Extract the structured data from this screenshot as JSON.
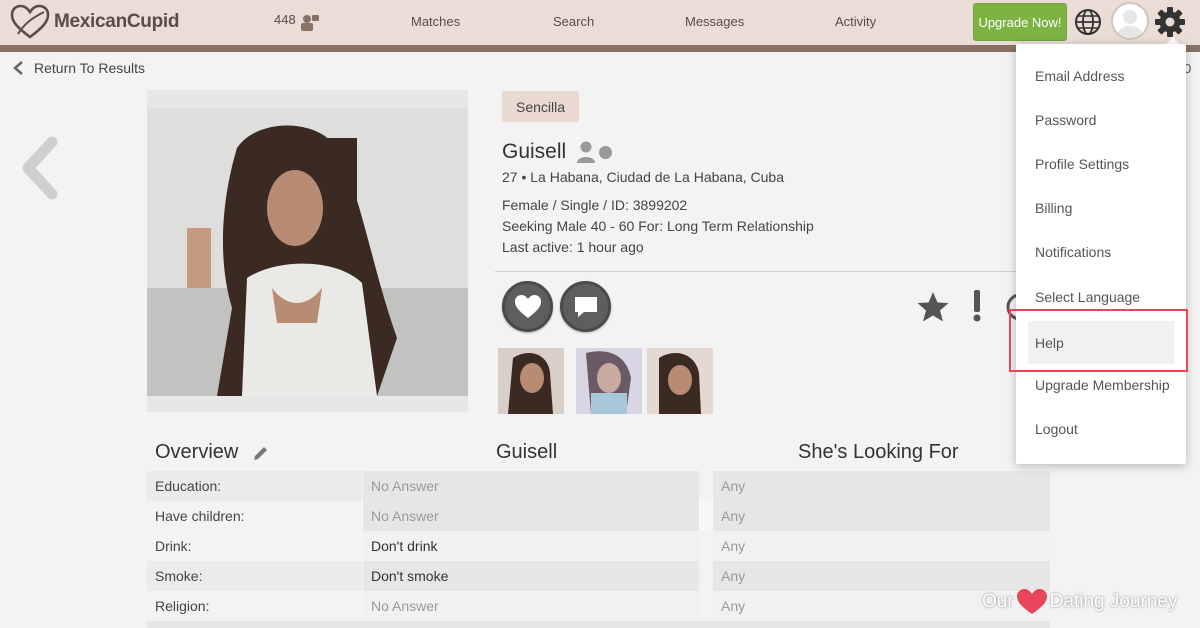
{
  "header": {
    "logo_text": "MexicanCupid",
    "online_count": "448",
    "nav": [
      "Matches",
      "Search",
      "Messages",
      "Activity"
    ],
    "upgrade_label": "Upgrade Now!"
  },
  "back_label": "Return To Results",
  "right_digit": "0",
  "profile": {
    "tag": "Sencilla",
    "name": "Guisell",
    "location": "27 • La Habana, Ciudad de La Habana, Cuba",
    "details": "Female / Single / ID: 3899202",
    "seeking": "Seeking Male 40 - 60 For: Long Term Relationship",
    "last_active": "Last active: 1 hour ago"
  },
  "sections": {
    "overview": "Overview",
    "her": "Guisell",
    "looking": "She's Looking For"
  },
  "table": [
    {
      "label": "Education:",
      "value": "No Answer",
      "looking": "Any"
    },
    {
      "label": "Have children:",
      "value": "No Answer",
      "looking": "Any"
    },
    {
      "label": "Drink:",
      "value": "Don't drink",
      "looking": "Any"
    },
    {
      "label": "Smoke:",
      "value": "Don't smoke",
      "looking": "Any"
    },
    {
      "label": "Religion:",
      "value": "No Answer",
      "looking": "Any"
    }
  ],
  "menu": {
    "items": [
      "Email Address",
      "Password",
      "Profile Settings",
      "Billing",
      "Notifications",
      "Select Language",
      "Help",
      "Upgrade Membership",
      "Logout"
    ],
    "highlighted": "Help"
  },
  "watermark": {
    "left": "Our",
    "right": "Dating Journey"
  },
  "colors": {
    "accent_green": "#7cb342",
    "header_bg": "#e9ddd5",
    "highlight_border": "#e9465d"
  }
}
